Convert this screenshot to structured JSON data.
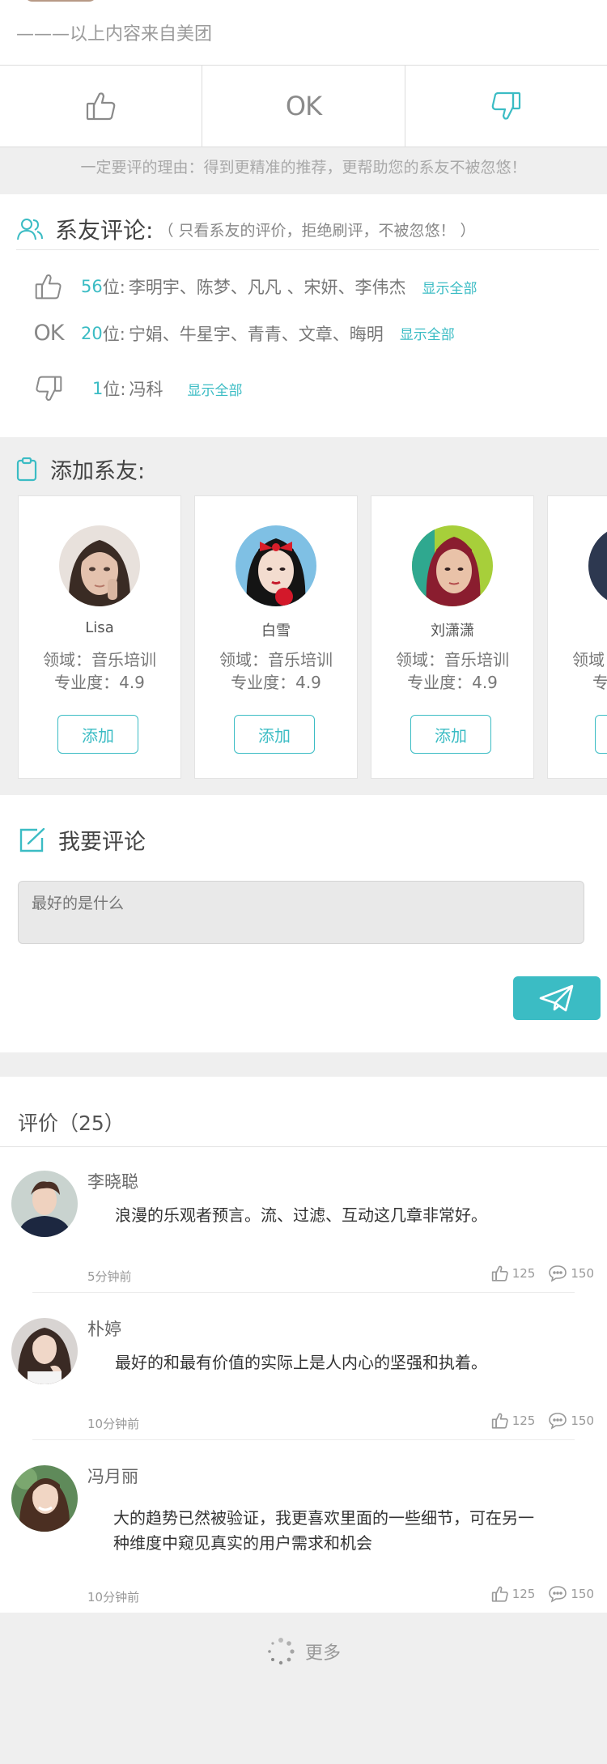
{
  "source_note": "———以上内容来自美团",
  "vote_bar": {
    "ok_label": "OK"
  },
  "reason_text": "一定要评的理由：得到更精准的推荐，更帮助您的系友不被忽悠！",
  "friend_reviews": {
    "title": "系友评论:",
    "subtitle": "（ 只看系友的评价，拒绝刷评，不被忽悠！ ）",
    "show_all": "显示全部",
    "rows": [
      {
        "type": "like",
        "count": "56",
        "unit": "位:",
        "names": "李明宇、陈梦、凡凡 、宋妍、李伟杰"
      },
      {
        "type": "ok",
        "label": "OK",
        "count": "20",
        "unit": "位:",
        "names": "宁娟、牛星宇、青青、文章、晦明"
      },
      {
        "type": "dislike",
        "count": "1",
        "unit": "位:",
        "names": "冯科"
      }
    ]
  },
  "add_friends": {
    "title": "添加系友:",
    "add_label": "添加",
    "cards": [
      {
        "name": "Lisa",
        "field": "领域：音乐培训",
        "score": "专业度：4.9"
      },
      {
        "name": "白雪",
        "field": "领域：音乐培训",
        "score": "专业度：4.9"
      },
      {
        "name": "刘潇潇",
        "field": "领域：音乐培训",
        "score": "专业度：4.9"
      },
      {
        "name": "",
        "field": "领域",
        "score": "专"
      }
    ]
  },
  "comment": {
    "title": "我要评论",
    "placeholder": "最好的是什么"
  },
  "reviews": {
    "title": "评价（25）",
    "items": [
      {
        "name": "李晓聪",
        "text": "浪漫的乐观者预言。流、过滤、互动这几章非常好。",
        "time": "5分钟前",
        "likes": "125",
        "comments": "150"
      },
      {
        "name": "朴婷",
        "text": "最好的和最有价值的实际上是人内心的坚强和执着。",
        "time": "10分钟前",
        "likes": "125",
        "comments": "150"
      },
      {
        "name": "冯月丽",
        "text": "大的趋势已然被验证，我更喜欢里面的一些细节，可在另一种维度中窥见真实的用户需求和机会",
        "time": "10分钟前",
        "likes": "125",
        "comments": "150"
      }
    ]
  },
  "more_label": "更多",
  "colors": {
    "accent": "#3bbcc4",
    "background": "#efefef"
  }
}
